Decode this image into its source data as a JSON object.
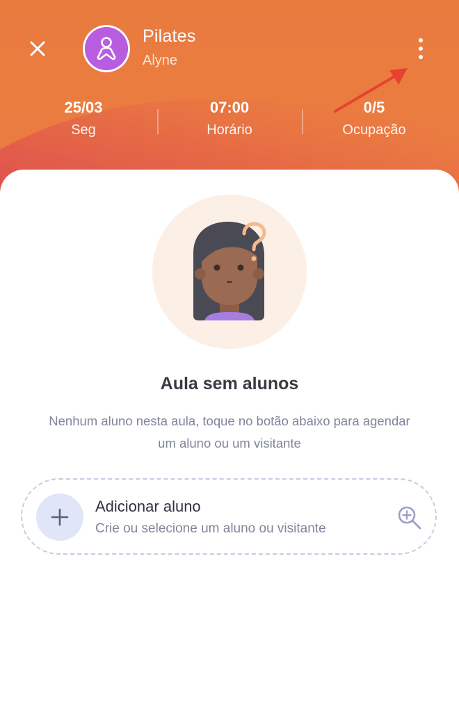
{
  "header": {
    "title": "Pilates",
    "subtitle": "Alyne",
    "colors": {
      "primary": "#eb7d42",
      "avatar": "#b85de0",
      "wave": "#e0544d"
    },
    "icons": {
      "close": "close-icon",
      "avatar": "person-icon",
      "menu": "more-vertical-icon"
    }
  },
  "stats": [
    {
      "value": "25/03",
      "label": "Seg"
    },
    {
      "value": "07:00",
      "label": "Horário"
    },
    {
      "value": "0/5",
      "label": "Ocupação"
    }
  ],
  "empty_state": {
    "title": "Aula sem alunos",
    "description": "Nenhum aluno nesta aula, toque no botão abaixo para agendar um aluno ou um visitante",
    "illustration": "confused-woman-question-mark"
  },
  "add_student": {
    "title": "Adicionar aluno",
    "subtitle": "Crie ou selecione um aluno ou visitante",
    "icons": {
      "add": "plus-icon",
      "search": "zoom-in-icon"
    }
  },
  "annotation": {
    "arrow_color": "#e8412e"
  }
}
